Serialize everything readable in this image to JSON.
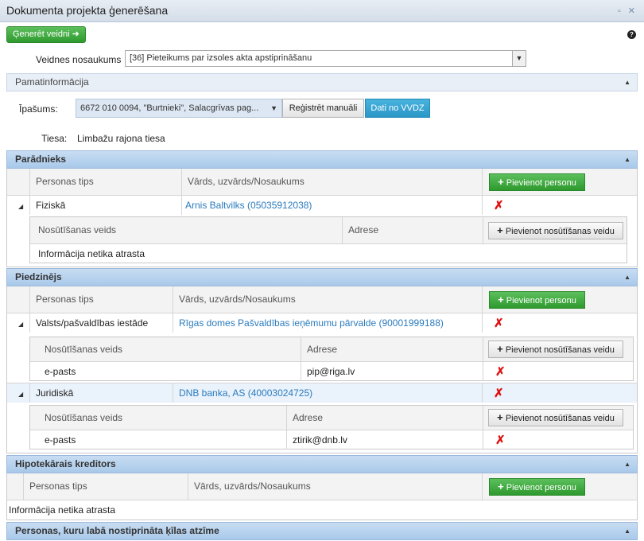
{
  "window": {
    "title": "Dokumenta projekta ģenerēšana",
    "controls": "▫ ✕"
  },
  "toolbar": {
    "generate_label": "Ģenerēt veidni ➜",
    "help": "?"
  },
  "template": {
    "label": "Veidnes nosaukums",
    "value": "[36] Pieteikums par izsoles akta apstiprināšanu"
  },
  "sections": {
    "basic": "Pamatinformācija",
    "debtor": "Parādnieks",
    "notified": "Piedzinējs",
    "mortgage": "Hipotekārais kreditors",
    "pledge": "Personas, kuru labā nostiprināta ķīlas atzīme"
  },
  "basic": {
    "property_label": "Īpašums:",
    "property_value": "6672 010 0094, \"Burtnieki\", Salacgrīvas pag...",
    "register_manual": "Reģistrēt manuāli",
    "from_vvdz": "Dati no VVDZ",
    "court_label": "Tiesa:",
    "court_value": "Limbažu rajona tiesa"
  },
  "cols": {
    "person_type": "Personas tips",
    "name": "Vārds, uzvārds/Nosaukums",
    "add_person": "Pievienot personu",
    "delivery": "Nosūtīšanas veids",
    "address": "Adrese",
    "add_delivery": "Pievienot nosūtīšanas veidu",
    "no_info": "Informācija netika atrasta"
  },
  "debtor": {
    "type": "Fiziskā",
    "name": "Arnis Baltvilks (05035912038)"
  },
  "notified": [
    {
      "type": "Valsts/pašvaldības iestāde",
      "name": "Rīgas domes Pašvaldības ieņēmumu pārvalde (90001999188)",
      "delivery": "e-pasts",
      "address": "pip@riga.lv"
    },
    {
      "type": "Juridiskā",
      "name": "DNB banka, AS (40003024725)",
      "delivery": "e-pasts",
      "address": "ztirik@dnb.lv"
    }
  ]
}
